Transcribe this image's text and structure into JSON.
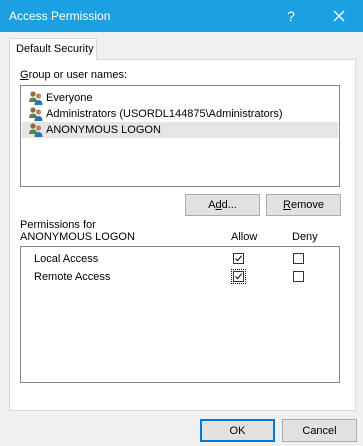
{
  "window": {
    "title": "Access Permission",
    "help_label": "?",
    "close_icon": "close-icon"
  },
  "tabs": [
    {
      "label": "Default Security"
    }
  ],
  "group_section": {
    "label_underlined": "G",
    "label_rest": "roup or user names:",
    "users": [
      {
        "name": "Everyone",
        "icon": "users-icon",
        "selected": false
      },
      {
        "name": "Administrators (USORDL144875\\Administrators)",
        "icon": "users-icon",
        "selected": false
      },
      {
        "name": "ANONYMOUS LOGON",
        "icon": "users-icon",
        "selected": true
      }
    ]
  },
  "buttons": {
    "add_pre": "A",
    "add_underlined": "d",
    "add_post": "d...",
    "remove_pre": "",
    "remove_underlined": "R",
    "remove_post": "emove",
    "ok": "OK",
    "cancel": "Cancel"
  },
  "permissions": {
    "label": "Permissions for ANONYMOUS LOGON",
    "col_allow": "Allow",
    "col_deny": "Deny",
    "rows": [
      {
        "name": "Local Access",
        "allow": true,
        "deny": false
      },
      {
        "name": "Remote Access",
        "allow": true,
        "deny": false
      }
    ]
  },
  "colors": {
    "titlebar": "#1ba1e2",
    "focus_border": "#0078d7"
  }
}
